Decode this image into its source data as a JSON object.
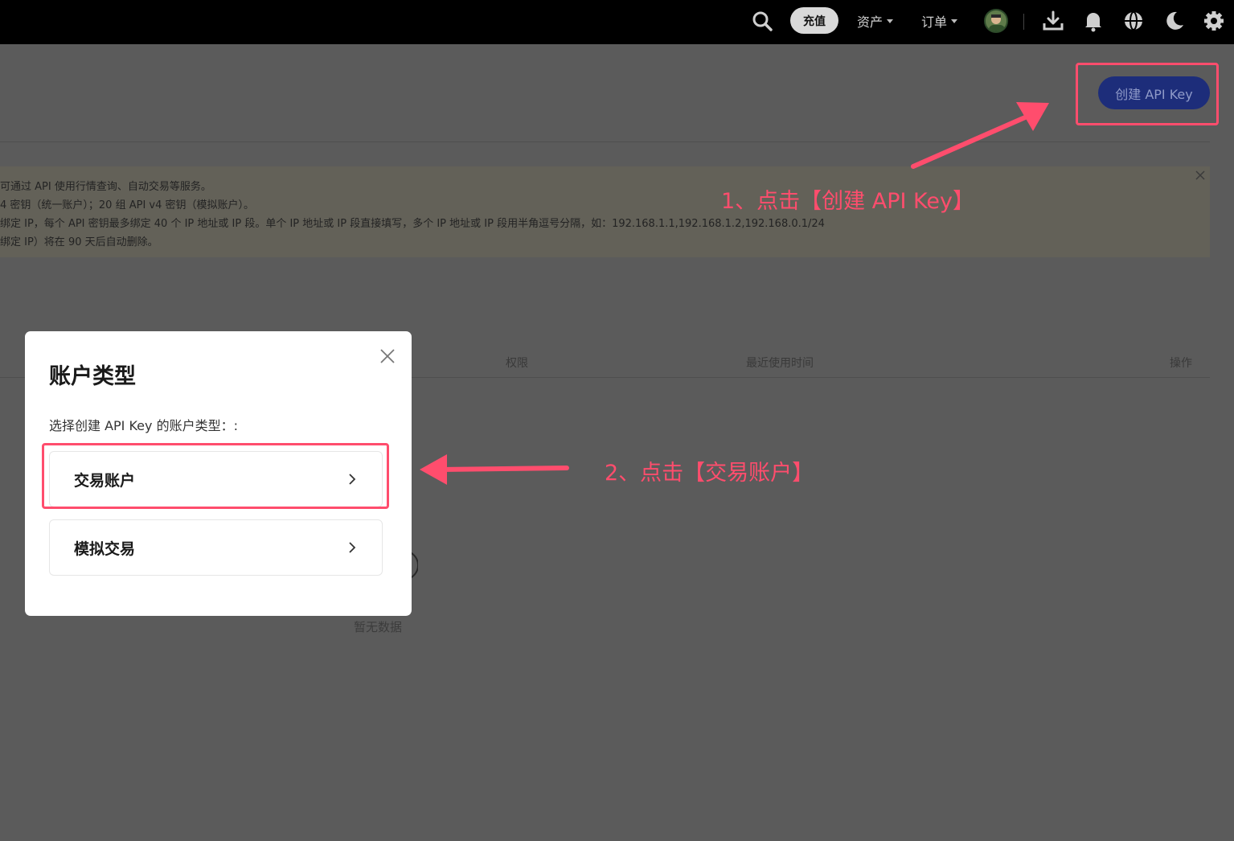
{
  "nav": {
    "recharge_label": "充值",
    "assets_label": "资产",
    "orders_label": "订单",
    "icons": [
      "search-icon",
      "download-icon",
      "bell-icon",
      "globe-icon",
      "moon-icon",
      "gear-icon"
    ]
  },
  "page": {
    "create_api_key_label": "创建 API Key",
    "notice_lines": [
      "可通过 API 使用行情查询、自动交易等服务。",
      "4 密钥（统一账户）；20 组 API v4 密钥（模拟账户）。",
      "绑定 IP，每个 API 密钥最多绑定 40 个 IP 地址或 IP 段。单个 IP 地址或 IP 段直接填写，多个 IP 地址或 IP 段用半角逗号分隔，如：192.168.1.1,192.168.1.2,192.168.0.1/24",
      "绑定 IP）将在 90 天后自动删除。"
    ],
    "table_headers": {
      "permissions": "权限",
      "last_used": "最近使用时间",
      "actions": "操作"
    },
    "empty_text": "暂无数据"
  },
  "modal": {
    "title": "账户类型",
    "subtitle": "选择创建 API Key 的账户类型：:",
    "options": [
      {
        "label": "交易账户"
      },
      {
        "label": "模拟交易"
      }
    ]
  },
  "annotations": {
    "step1": "1、点击【创建 API Key】",
    "step2": "2、点击【交易账户】",
    "color": "#ff4d6d"
  }
}
